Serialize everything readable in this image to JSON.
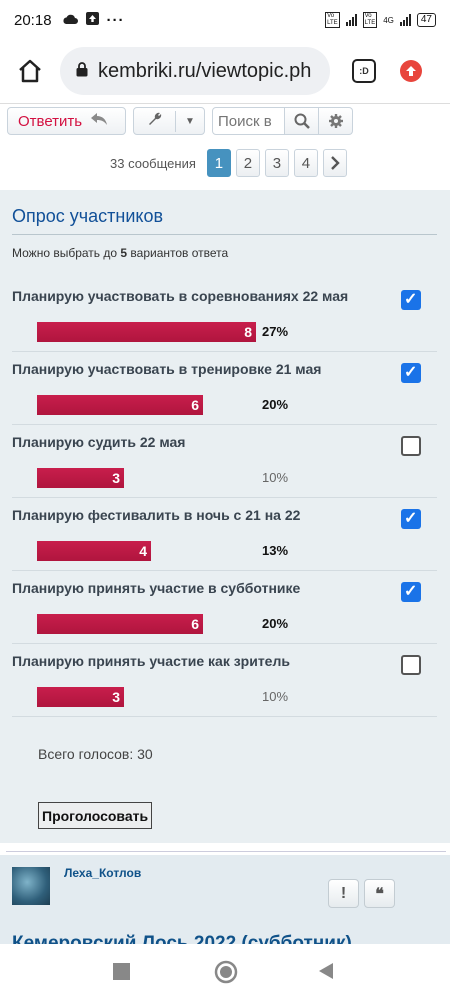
{
  "status": {
    "time": "20:18",
    "network_badge": "4G",
    "battery": "47"
  },
  "browser": {
    "url": "kembriki.ru/viewtopic.ph",
    "tab_label": ":D"
  },
  "actions": {
    "reply_label": "Ответить",
    "search_placeholder": "Поиск в"
  },
  "pagination": {
    "count_text": "33 сообщения",
    "pages": [
      "1",
      "2",
      "3",
      "4"
    ],
    "active_page": "1"
  },
  "poll": {
    "title": "Опрос участников",
    "hint_prefix": "Можно выбрать до ",
    "hint_count": "5",
    "hint_suffix": " вариантов ответа",
    "options": [
      {
        "label": "Планирую участвовать в соревнованиях 22 мая",
        "votes": "8",
        "percent": "27%",
        "checked": true
      },
      {
        "label": "Планирую участвовать в тренировке 21 мая",
        "votes": "6",
        "percent": "20%",
        "checked": true
      },
      {
        "label": "Планирую судить 22 мая",
        "votes": "3",
        "percent": "10%",
        "checked": false
      },
      {
        "label": "Планирую фестивалить в ночь с 21 на 22",
        "votes": "4",
        "percent": "13%",
        "checked": true
      },
      {
        "label": "Планирую принять участие в субботнике",
        "votes": "6",
        "percent": "20%",
        "checked": true
      },
      {
        "label": "Планирую принять участие как зритель",
        "votes": "3",
        "percent": "10%",
        "checked": false
      }
    ],
    "total_text": "Всего голосов: 30",
    "vote_label": "Проголосовать"
  },
  "post": {
    "author": "Леха_Котлов",
    "report_label": "!",
    "quote_label": "❝",
    "title_partial": "Кемеровский Лось 2022 (субботник)"
  },
  "colors": {
    "bar": "#c81e4c",
    "link": "#105289",
    "accent": "#4692bf",
    "checkbox": "#1a73e8"
  }
}
